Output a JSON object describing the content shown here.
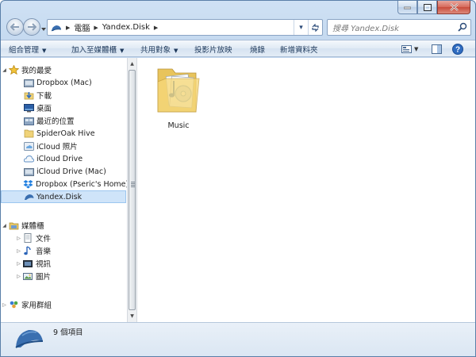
{
  "address": {
    "crumbs": [
      "電腦",
      "Yandex.Disk"
    ]
  },
  "search": {
    "placeholder": "搜尋 Yandex.Disk"
  },
  "toolbar": {
    "organize": "組合管理",
    "include_library": "加入至媒體櫃",
    "share_with": "共用對象",
    "slideshow": "投影片放映",
    "burn": "燒錄",
    "new_folder": "新增資料夾"
  },
  "sidebar": {
    "favorites": {
      "label": "我的最愛",
      "items": [
        {
          "label": "Dropbox (Mac)",
          "icon": "dropbox-mac-icon"
        },
        {
          "label": "下載",
          "icon": "downloads-icon"
        },
        {
          "label": "桌面",
          "icon": "desktop-icon"
        },
        {
          "label": "最近的位置",
          "icon": "recent-places-icon"
        },
        {
          "label": "SpiderOak Hive",
          "icon": "spideroak-icon"
        },
        {
          "label": "iCloud 照片",
          "icon": "icloud-photos-icon"
        },
        {
          "label": "iCloud Drive",
          "icon": "icloud-drive-icon"
        },
        {
          "label": "iCloud Drive (Mac)",
          "icon": "icloud-drive-mac-icon"
        },
        {
          "label": "Dropbox (Pseric's Home)",
          "icon": "dropbox-icon"
        },
        {
          "label": "Yandex.Disk",
          "icon": "yandex-disk-icon",
          "selected": true
        }
      ]
    },
    "libraries": {
      "label": "媒體櫃",
      "items": [
        {
          "label": "文件",
          "icon": "documents-icon"
        },
        {
          "label": "音樂",
          "icon": "music-icon"
        },
        {
          "label": "視訊",
          "icon": "videos-icon"
        },
        {
          "label": "圖片",
          "icon": "pictures-icon"
        }
      ]
    },
    "homegroup": {
      "label": "家用群組"
    }
  },
  "content": {
    "items": [
      {
        "label": "Music",
        "icon": "music-folder-icon"
      }
    ]
  },
  "details": {
    "count": "9 個項目"
  },
  "colors": {
    "selection": "#cfe4f9",
    "frame": "#c3d8ef",
    "close_button": "#c84b3b"
  }
}
